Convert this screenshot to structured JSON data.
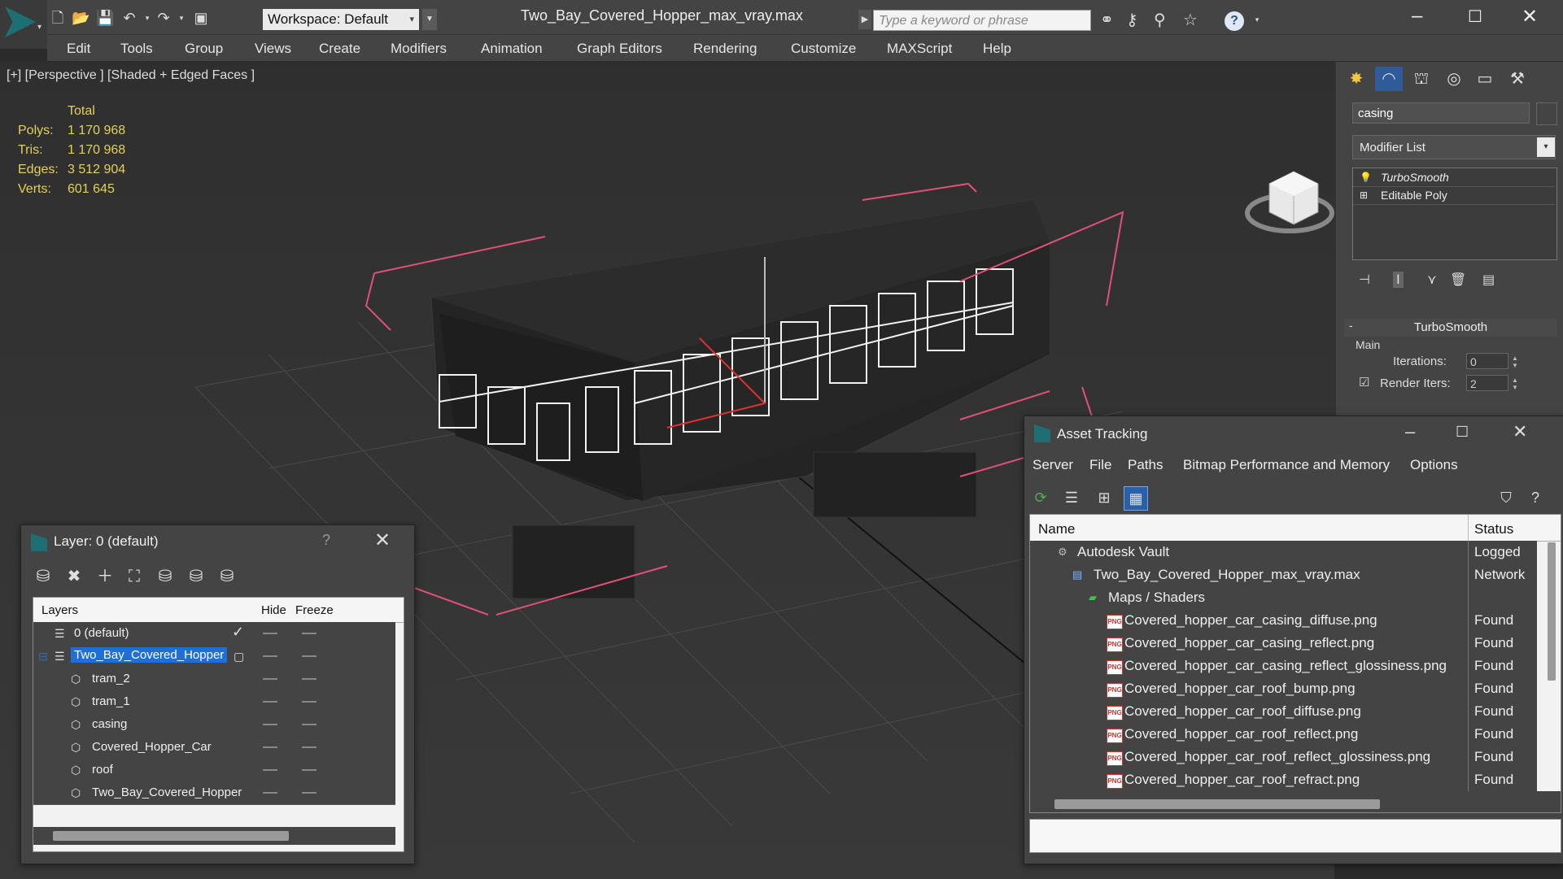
{
  "app": {
    "document_title": "Two_Bay_Covered_Hopper_max_vray.max",
    "workspace_label": "Workspace: Default",
    "search_placeholder": "Type a keyword or phrase",
    "help_label": "?"
  },
  "menubar": [
    "Edit",
    "Tools",
    "Group",
    "Views",
    "Create",
    "Modifiers",
    "Animation",
    "Graph Editors",
    "Rendering",
    "Customize",
    "MAXScript",
    "Help"
  ],
  "viewport": {
    "label": "[+] [Perspective ] [Shaded + Edged Faces ]",
    "stats": {
      "header": "Total",
      "rows": [
        {
          "key": "Polys:",
          "value": "1 170 968"
        },
        {
          "key": "Tris:",
          "value": "1 170 968"
        },
        {
          "key": "Edges:",
          "value": "3 512 904"
        },
        {
          "key": "Verts:",
          "value": "601 645"
        }
      ]
    }
  },
  "command_panel": {
    "object_name": "casing",
    "modifier_list_label": "Modifier List",
    "stack": [
      {
        "label": "TurboSmooth",
        "icon": "lightbulb-icon",
        "italic": true
      },
      {
        "label": "Editable Poly",
        "icon": "plus-icon",
        "italic": false
      }
    ],
    "rollout": {
      "title": "TurboSmooth",
      "collapse": "-",
      "group": "Main",
      "iterations_label": "Iterations:",
      "iterations_value": "0",
      "render_iters_label": "Render Iters:",
      "render_iters_value": "2",
      "render_iters_checked": true
    }
  },
  "layer_dialog": {
    "title": "Layer: 0 (default)",
    "help": "?",
    "columns": {
      "layers": "Layers",
      "hide": "Hide",
      "freeze": "Freeze"
    },
    "rows": [
      {
        "name": "0 (default)",
        "icon": "layer-stack-icon",
        "indent": 0,
        "current": true,
        "selected": false
      },
      {
        "name": "Two_Bay_Covered_Hopper",
        "icon": "layer-stack-icon",
        "indent": 0,
        "current": false,
        "selected": true
      },
      {
        "name": "tram_2",
        "icon": "object-icon",
        "indent": 1,
        "current": false,
        "selected": false
      },
      {
        "name": "tram_1",
        "icon": "object-icon",
        "indent": 1,
        "current": false,
        "selected": false
      },
      {
        "name": "casing",
        "icon": "object-icon",
        "indent": 1,
        "current": false,
        "selected": false
      },
      {
        "name": "Covered_Hopper_Car",
        "icon": "object-icon",
        "indent": 1,
        "current": false,
        "selected": false
      },
      {
        "name": "roof",
        "icon": "object-icon",
        "indent": 1,
        "current": false,
        "selected": false
      },
      {
        "name": "Two_Bay_Covered_Hopper",
        "icon": "object-icon",
        "indent": 1,
        "current": false,
        "selected": false
      }
    ]
  },
  "asset_dialog": {
    "title": "Asset Tracking",
    "menu": [
      "Server",
      "File",
      "Paths",
      "Bitmap Performance and Memory",
      "Options"
    ],
    "columns": {
      "name": "Name",
      "status": "Status"
    },
    "rows": [
      {
        "name": "Autodesk Vault",
        "status": "Logged",
        "icon": "vault-icon",
        "level": 1
      },
      {
        "name": "Two_Bay_Covered_Hopper_max_vray.max",
        "status": "Network",
        "icon": "max-file-icon",
        "level": 2
      },
      {
        "name": "Maps / Shaders",
        "status": "",
        "icon": "maps-folder-icon",
        "level": 3
      },
      {
        "name": "Covered_hopper_car_casing_diffuse.png",
        "status": "Found",
        "icon": "png-icon",
        "level": 4
      },
      {
        "name": "Covered_hopper_car_casing_reflect.png",
        "status": "Found",
        "icon": "png-icon",
        "level": 4
      },
      {
        "name": "Covered_hopper_car_casing_reflect_glossiness.png",
        "status": "Found",
        "icon": "png-icon",
        "level": 4
      },
      {
        "name": "Covered_hopper_car_roof_bump.png",
        "status": "Found",
        "icon": "png-icon",
        "level": 4
      },
      {
        "name": "Covered_hopper_car_roof_diffuse.png",
        "status": "Found",
        "icon": "png-icon",
        "level": 4
      },
      {
        "name": "Covered_hopper_car_roof_reflect.png",
        "status": "Found",
        "icon": "png-icon",
        "level": 4
      },
      {
        "name": "Covered_hopper_car_roof_reflect_glossiness.png",
        "status": "Found",
        "icon": "png-icon",
        "level": 4
      },
      {
        "name": "Covered_hopper_car_roof_refract.png",
        "status": "Found",
        "icon": "png-icon",
        "level": 4
      }
    ]
  },
  "colors": {
    "selection": "#1f6fd6",
    "stats_text": "#e3d05a",
    "bbox": "#e0507a"
  }
}
